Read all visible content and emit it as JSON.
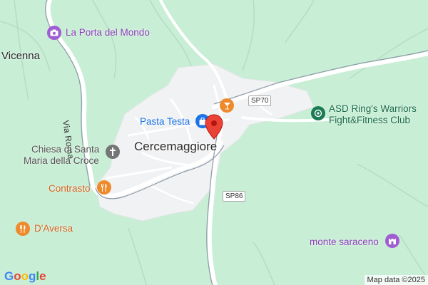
{
  "colors": {
    "land": "#c9eed6",
    "urban": "#f1f2f3",
    "road": "#ffffff",
    "stream": "#b0d9bd",
    "purple": "#a05cd3",
    "orange": "#ee8a2b",
    "blue": "#1a73e8",
    "gray": "#757575",
    "green": "#1b7a54",
    "pin": "#ea4335"
  },
  "labels": {
    "vicenna": "Vicenna",
    "cercemaggiore": "Cercemaggiore",
    "via_roma": "Via Roma",
    "sp70": "SP70",
    "sp86": "SP86"
  },
  "pois": {
    "porta_del_mondo": {
      "name": "La Porta del Mondo",
      "icon": "camera-icon"
    },
    "pasta_testa": {
      "name": "Pasta Testa",
      "icon": "shopping-bag-icon"
    },
    "chiesa_line1": "Chiesa di Santa",
    "chiesa_line2": "Maria della Croce",
    "chiesa_icon": "cross-icon",
    "contrasto": {
      "name": "Contrasto",
      "icon": "restaurant-icon"
    },
    "daversa": {
      "name": "D'Aversa",
      "icon": "restaurant-icon"
    },
    "bar_icon": "cocktail-icon",
    "asd_line1": "ASD Ring's Warriors",
    "asd_line2": "Fight&Fitness Club",
    "asd_icon": "fitness-icon",
    "monte_saraceno": {
      "name": "monte saraceno",
      "icon": "castle-icon"
    }
  },
  "marker": {
    "icon": "location-pin-icon"
  },
  "footer": {
    "logo": "Google",
    "attribution": "Map data ©2025"
  }
}
